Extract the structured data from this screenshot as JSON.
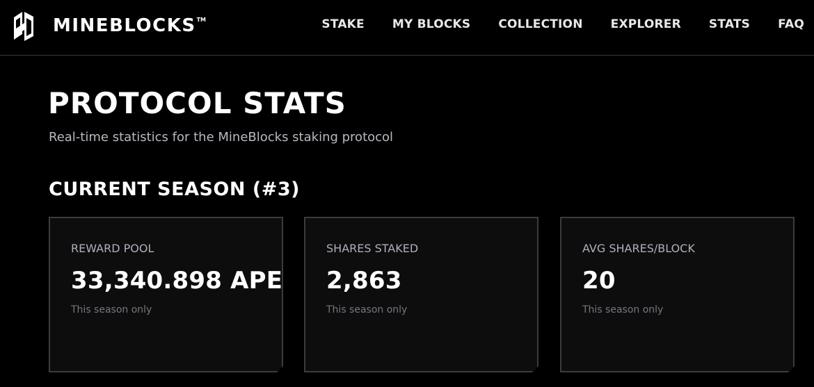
{
  "header": {
    "logo_text": "MINEBLOCKS",
    "logo_trademark": "TM",
    "logo_icon": "mineblocks-logo-icon",
    "nav": [
      {
        "label": "STAKE"
      },
      {
        "label": "MY BLOCKS"
      },
      {
        "label": "COLLECTION"
      },
      {
        "label": "EXPLORER"
      },
      {
        "label": "STATS"
      },
      {
        "label": "FAQ"
      }
    ]
  },
  "main": {
    "title": "PROTOCOL STATS",
    "subtitle": "Real-time statistics for the MineBlocks staking protocol",
    "section_title": "CURRENT SEASON (#3)",
    "cards": [
      {
        "label": "REWARD POOL",
        "value": "33,340.898 APE",
        "note": "This season only"
      },
      {
        "label": "SHARES STAKED",
        "value": "2,863",
        "note": "This season only"
      },
      {
        "label": "AVG SHARES/BLOCK",
        "value": "20",
        "note": "This season only"
      }
    ]
  },
  "colors": {
    "background": "#000000",
    "card_background": "#0d0d0d",
    "card_border": "#3c3c3c",
    "text_primary": "#ffffff",
    "text_secondary": "#b8b8c2",
    "text_muted": "#767684"
  }
}
